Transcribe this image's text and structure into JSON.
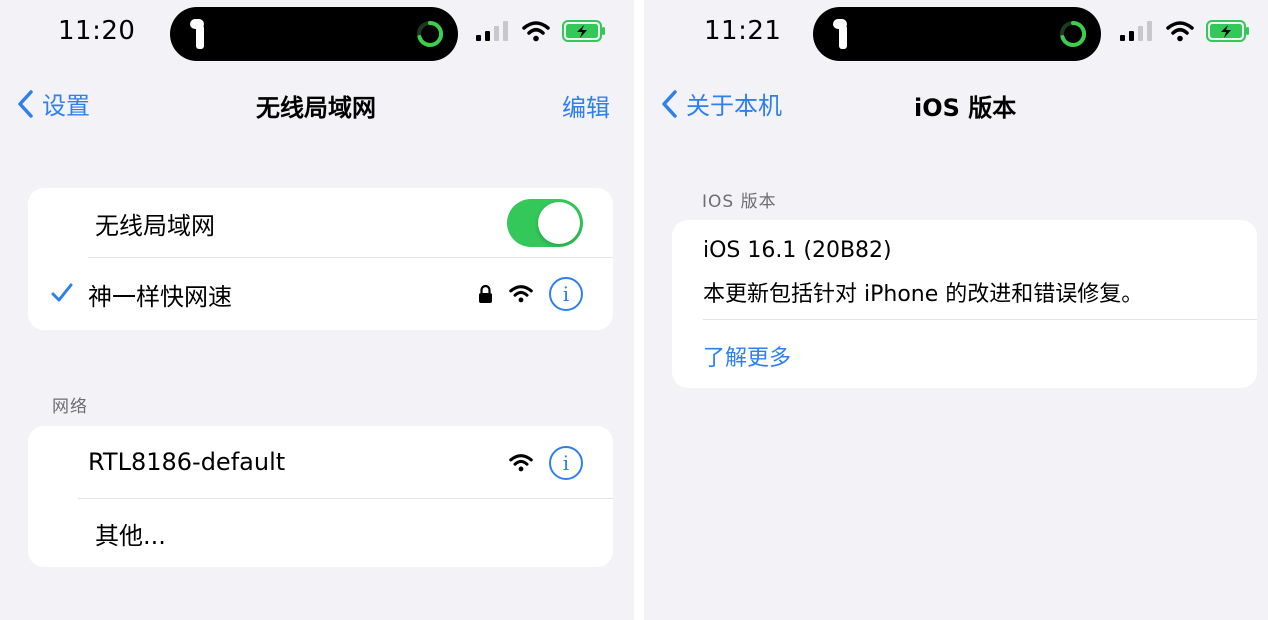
{
  "left": {
    "status": {
      "time": "11:20"
    },
    "nav": {
      "back_label": "设置",
      "title": "无线局域网",
      "action_label": "编辑"
    },
    "wifi_group": {
      "toggle_label": "无线局域网",
      "toggle_on": true,
      "connected_network": "神一样快网速"
    },
    "networks_section": {
      "header": "网络",
      "items": [
        "RTL8186-default",
        "其他..."
      ]
    }
  },
  "right": {
    "status": {
      "time": "11:21"
    },
    "nav": {
      "back_label": "关于本机",
      "title": "iOS 版本"
    },
    "section_header": "IOS 版本",
    "version": {
      "title": "iOS 16.1 (20B82)",
      "description": "本更新包括针对 iPhone 的改进和错误修复。",
      "learn_more": "了解更多"
    }
  },
  "colors": {
    "accent": "#2f80ed",
    "toggle_on": "#34c759",
    "background": "#f2f2f7",
    "battery": "#34c759"
  },
  "icons": [
    "airpods-icon",
    "activity-ring-icon",
    "cellular-signal-icon",
    "wifi-icon",
    "battery-charging-icon",
    "chevron-left-icon",
    "checkmark-icon",
    "lock-icon",
    "info-icon"
  ]
}
